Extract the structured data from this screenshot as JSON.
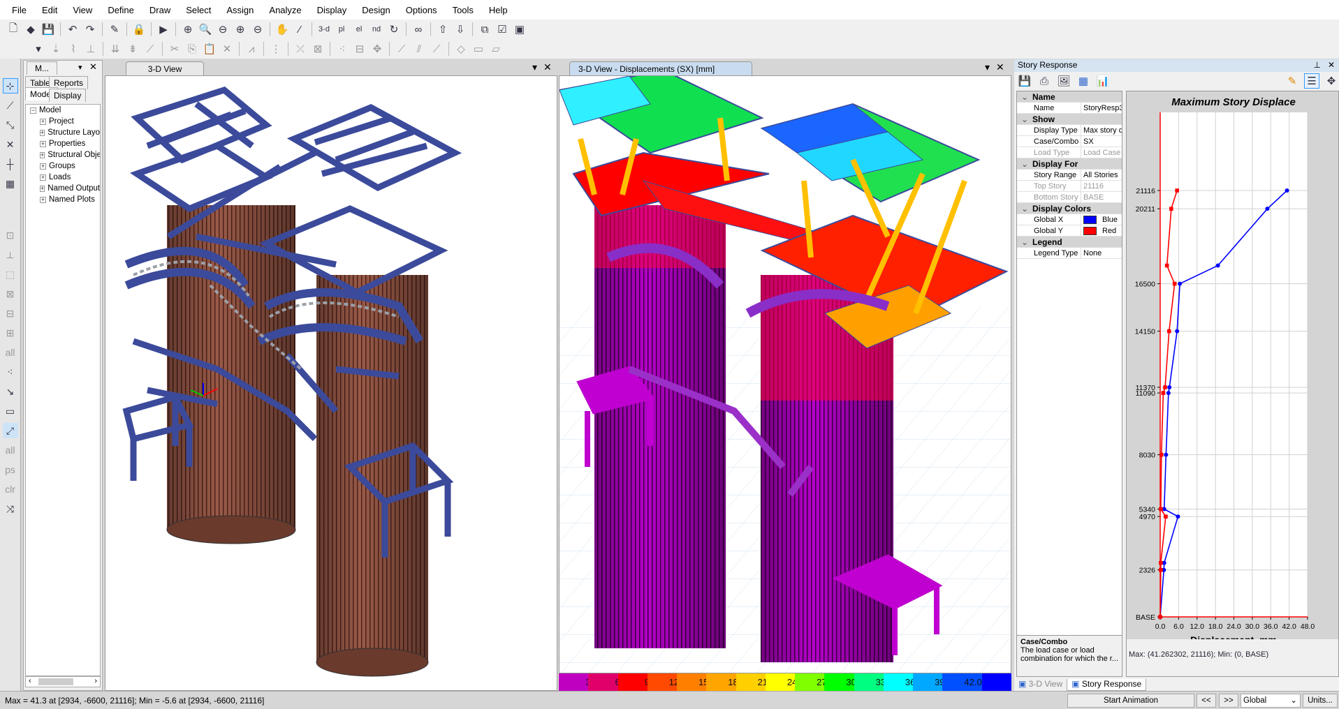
{
  "menu": [
    "File",
    "Edit",
    "View",
    "Define",
    "Draw",
    "Select",
    "Assign",
    "Analyze",
    "Display",
    "Design",
    "Options",
    "Tools",
    "Help"
  ],
  "toolbar1_icons": [
    "new-icon",
    "open-icon",
    "save-icon",
    "|",
    "undo-icon",
    "redo-icon",
    "|",
    "pencil-icon",
    "|",
    "lock-icon",
    "|",
    "run-icon",
    "|",
    "zoom-window-icon",
    "zoom-restore-icon",
    "zoom-previous-icon",
    "zoom-in-icon",
    "zoom-out-icon",
    "|",
    "pan-icon",
    "rubber-band-icon",
    "|",
    "3d-view-icon",
    "plan-view-icon",
    "elevation-view-icon",
    "nd-view-icon",
    "rotate-icon",
    "|",
    "perspective-icon",
    "|",
    "up-icon",
    "down-icon",
    "|",
    "object-shrink-icon",
    "check-icon",
    "extrude-icon"
  ],
  "toolbar1_texts": {
    "3d": "3-d",
    "plan": "pl",
    "elev": "el",
    "nd": "nd"
  },
  "toolbar2_icons": [
    "dropdown-icon",
    "point-load-icon",
    "spring-icon",
    "restraint-icon",
    "|",
    "frame-load-icon",
    "area-load-icon",
    "release-icon",
    "|",
    "cut-icon",
    "copy-icon",
    "paste-icon",
    "delete-icon",
    "|",
    "replicate-icon",
    "|",
    "divide-icon",
    "|",
    "join-icon",
    "mesh-icon",
    "|",
    "merge-icon",
    "align-icon",
    "move-icon",
    "|",
    "link-icon",
    "link2-icon",
    "link3-icon",
    "|",
    "area-icon",
    "wall-icon",
    "slab-icon"
  ],
  "explorer": {
    "tab": "M...",
    "tabs": [
      "Tables",
      "Reports",
      "Model",
      "Display"
    ],
    "root": "Model",
    "items": [
      "Project",
      "Structure Layout",
      "Properties",
      "Structural Objects",
      "Groups",
      "Loads",
      "Named Outputs",
      "Named Plots"
    ]
  },
  "left_view": {
    "tab": "3-D View"
  },
  "right_view": {
    "tab": "3-D View   - Displacements (SX)  [mm]"
  },
  "contour_legend": {
    "labels": [
      "3.0",
      "6.0",
      "9.0",
      "12.0",
      "15.0",
      "18.0",
      "21.0",
      "24.0",
      "27.0",
      "30.0",
      "33.0",
      "36.0",
      "39.0",
      "42.0"
    ],
    "colors": [
      "#c000c0",
      "#e0006a",
      "#ff0000",
      "#ff4a00",
      "#ff8000",
      "#ffa500",
      "#ffd000",
      "#ffff00",
      "#80ff00",
      "#00ff00",
      "#00ff80",
      "#00ffff",
      "#00a8ff",
      "#0050ff",
      "#0000ff"
    ]
  },
  "story_response": {
    "title": "Story Response",
    "toolbar_icons": [
      "save-icon",
      "print-icon",
      "image-icon",
      "table-icon",
      "chart-icon",
      "pencil-icon",
      "tree-icon",
      "move-icon"
    ],
    "sections": [
      {
        "title": "Name",
        "rows": [
          {
            "k": "Name",
            "v": "StoryResp3"
          }
        ]
      },
      {
        "title": "Show",
        "rows": [
          {
            "k": "Display Type",
            "v": "Max story displacement"
          },
          {
            "k": "Case/Combo",
            "v": "SX"
          },
          {
            "k": "Load Type",
            "v": "Load Case",
            "disabled": true
          }
        ]
      },
      {
        "title": "Display For",
        "rows": [
          {
            "k": "Story Range",
            "v": "All Stories"
          },
          {
            "k": "Top Story",
            "v": "21116",
            "disabled": true
          },
          {
            "k": "Bottom Story",
            "v": "BASE",
            "disabled": true
          }
        ]
      },
      {
        "title": "Display Colors",
        "rows": [
          {
            "k": "Global X",
            "v": "Blue",
            "swatch": "#0000ff"
          },
          {
            "k": "Global Y",
            "v": "Red",
            "swatch": "#ff0000"
          }
        ]
      },
      {
        "title": "Legend",
        "rows": [
          {
            "k": "Legend Type",
            "v": "None"
          }
        ]
      }
    ],
    "description": {
      "title": "Case/Combo",
      "text": "The load case or load combination for which the r..."
    },
    "footer": "Max: (41.262302, 21116);   Min: (0, BASE)",
    "bottom_tabs": [
      "3-D View",
      "Story Response"
    ]
  },
  "chart_data": {
    "type": "line",
    "title": "Maximum Story Displace",
    "xlabel": "Displacement, mm",
    "ylabel": "",
    "xlim": [
      0,
      48
    ],
    "xticks": [
      "0.0",
      "6.0",
      "12.0",
      "18.0",
      "24.0",
      "30.0",
      "36.0",
      "42.0",
      "48.0"
    ],
    "ylim": [
      0,
      21116
    ],
    "yticks": [
      {
        "label": "21116",
        "value": 21116
      },
      {
        "label": "20211",
        "value": 20211
      },
      {
        "label": "16500",
        "value": 16500
      },
      {
        "label": "14150",
        "value": 14150
      },
      {
        "label": "11370",
        "value": 11370
      },
      {
        "label": "11090",
        "value": 11090
      },
      {
        "label": "8030",
        "value": 8030
      },
      {
        "label": "5340",
        "value": 5340
      },
      {
        "label": "4970",
        "value": 4970
      },
      {
        "label": "2326",
        "value": 2326
      },
      {
        "label": "BASE",
        "value": 0
      }
    ],
    "grid": true,
    "series": [
      {
        "name": "Global X",
        "color": "#0000ff",
        "marker": "circle",
        "points": [
          [
            0,
            0
          ],
          [
            1.2,
            2326
          ],
          [
            1.3,
            2675
          ],
          [
            5.8,
            4970
          ],
          [
            1.3,
            5340
          ],
          [
            1.9,
            8030
          ],
          [
            2.7,
            11090
          ],
          [
            3.0,
            11370
          ],
          [
            5.5,
            14150
          ],
          [
            6.4,
            16500
          ],
          [
            18.8,
            17400
          ],
          [
            34.9,
            20211
          ],
          [
            41.3,
            21116
          ]
        ]
      },
      {
        "name": "Global Y",
        "color": "#ff0000",
        "marker": "square",
        "points": [
          [
            0,
            0
          ],
          [
            0.2,
            2326
          ],
          [
            0.2,
            2675
          ],
          [
            1.8,
            4970
          ],
          [
            0.2,
            5340
          ],
          [
            0.4,
            8030
          ],
          [
            1.0,
            11090
          ],
          [
            1.6,
            11370
          ],
          [
            2.9,
            14150
          ],
          [
            4.7,
            16500
          ],
          [
            2.2,
            17400
          ],
          [
            3.6,
            20211
          ],
          [
            5.5,
            21116
          ]
        ]
      }
    ]
  },
  "status": {
    "text": "Max = 41.3 at [2934, -6600, 21116];  Min = -5.6 at [2934, -6600, 21116]",
    "start_animation": "Start Animation",
    "prev": "<<",
    "next": ">>",
    "coord_system": "Global",
    "units": "Units..."
  }
}
